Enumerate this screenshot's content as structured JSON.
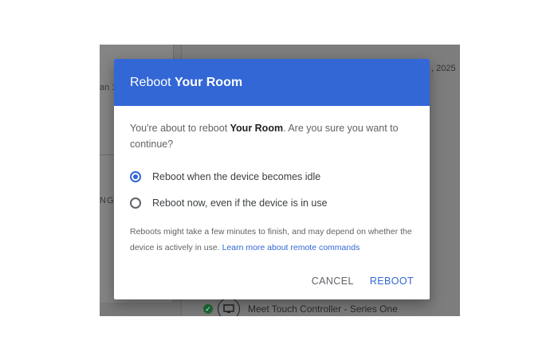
{
  "background": {
    "left_partial_text": "an 1",
    "left_partial_heading": "NG",
    "date_partial": ", 2025",
    "device_name": "Meet Touch Controller - Series One"
  },
  "dialog": {
    "title_prefix": "Reboot ",
    "title_room": "Your Room",
    "body_prefix": "You're about to reboot ",
    "body_room": "Your Room",
    "body_suffix": ". Are you sure you want to continue?",
    "options": [
      {
        "label": "Reboot when the device becomes idle",
        "selected": true
      },
      {
        "label": "Reboot now, even if the device is in use",
        "selected": false
      }
    ],
    "note_text": "Reboots might take a few minutes to finish, and may depend on whether the device is actively in use. ",
    "note_link": "Learn more about remote commands",
    "cancel_label": "CANCEL",
    "reboot_label": "REBOOT"
  },
  "colors": {
    "accent": "#3367d6",
    "header_bg": "#3367d6",
    "overlay": "#7a7a7a"
  }
}
